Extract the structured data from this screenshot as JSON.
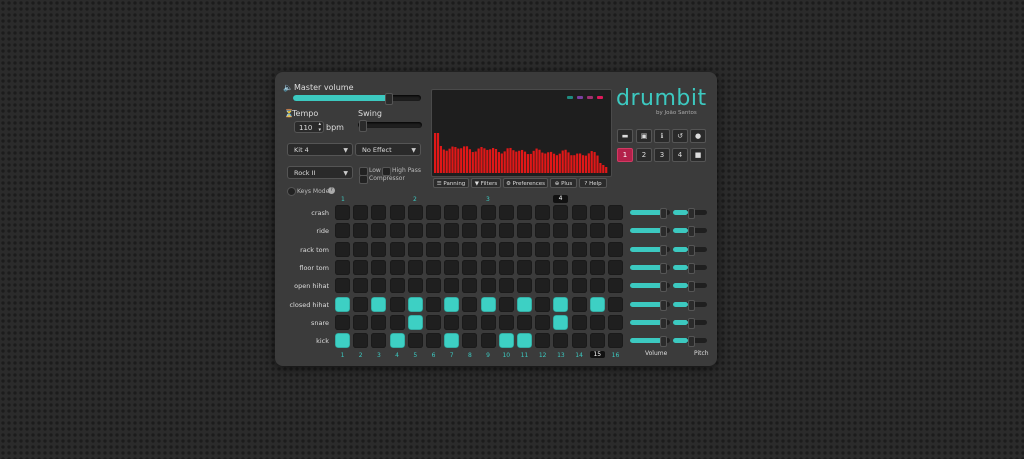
{
  "master": {
    "label": "Master volume",
    "level": 0.74
  },
  "tempo": {
    "label": "Tempo",
    "value": "110",
    "unit": "bpm"
  },
  "swing": {
    "label": "Swing",
    "level": 0.02
  },
  "kit_select": "Kit 4",
  "effect_select": "No Effect",
  "pattern_select": "Rock II",
  "filters": {
    "low": "Low",
    "high_pass": "High Pass",
    "compressor": "Compressor"
  },
  "keys_mode": "Keys Mode",
  "brand": {
    "title": "drumbit",
    "byline": "by João Santos",
    "accent": "#3cc9c0"
  },
  "toolbar": {
    "panning": "Panning",
    "filters": "Filters",
    "preferences": "Preferences",
    "plus": "Plus",
    "help": "Help"
  },
  "pattern_buttons": [
    "1",
    "2",
    "3",
    "4"
  ],
  "bar_numbers": [
    "1",
    "2",
    "3",
    "4"
  ],
  "current_bar": "4",
  "tracks": [
    {
      "name": "crash",
      "steps": [],
      "volume": 0.8,
      "pitch": 0.45
    },
    {
      "name": "ride",
      "steps": [],
      "volume": 0.8,
      "pitch": 0.45
    },
    {
      "name": "rack tom",
      "steps": [],
      "volume": 0.8,
      "pitch": 0.45
    },
    {
      "name": "floor tom",
      "steps": [],
      "volume": 0.8,
      "pitch": 0.45
    },
    {
      "name": "open hihat",
      "steps": [],
      "volume": 0.8,
      "pitch": 0.45
    },
    {
      "name": "closed hihat",
      "steps": [
        1,
        3,
        5,
        7,
        9,
        11,
        13,
        15
      ],
      "volume": 0.8,
      "pitch": 0.45
    },
    {
      "name": "snare",
      "steps": [
        5,
        13
      ],
      "volume": 0.8,
      "pitch": 0.45
    },
    {
      "name": "kick",
      "steps": [
        1,
        4,
        7,
        10,
        11
      ],
      "volume": 0.8,
      "pitch": 0.45
    }
  ],
  "step_numbers": [
    "1",
    "2",
    "3",
    "4",
    "5",
    "6",
    "7",
    "8",
    "9",
    "10",
    "11",
    "12",
    "13",
    "14",
    "15",
    "16"
  ],
  "current_step": "15",
  "column_labels": {
    "volume": "Volume",
    "pitch": "Pitch"
  },
  "visualizer": {
    "bar_color": "#e01818",
    "dot_colors": [
      "#1f8a80",
      "#7a3fa0",
      "#a03070",
      "#e0185a"
    ]
  }
}
